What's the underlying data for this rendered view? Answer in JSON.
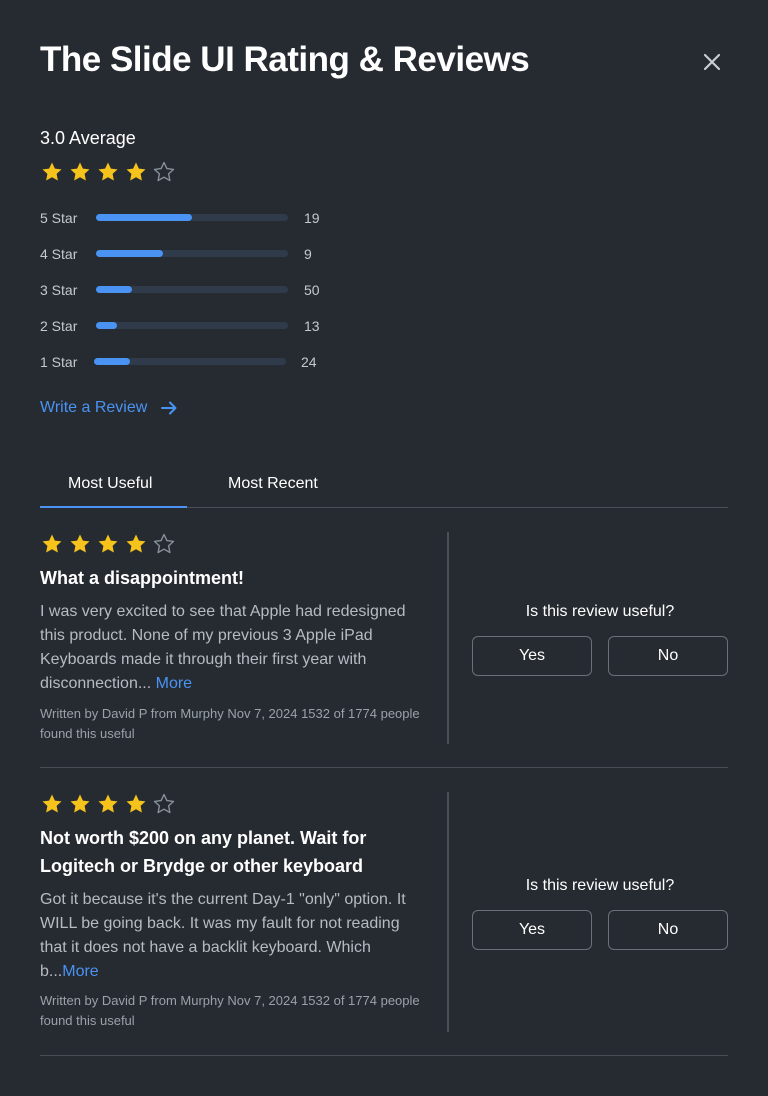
{
  "header": {
    "title": "The Slide UI Rating & Reviews"
  },
  "summary": {
    "average_label": "3.0 Average",
    "stars": 4,
    "max_stars": 5
  },
  "distribution": [
    {
      "label": "5 Star",
      "count": "19",
      "fill": 0.5
    },
    {
      "label": "4 Star",
      "count": "9",
      "fill": 0.35
    },
    {
      "label": "3 Star",
      "count": "50",
      "fill": 0.19
    },
    {
      "label": "2 Star",
      "count": "13",
      "fill": 0.11
    },
    {
      "label": "1 Star",
      "count": "24",
      "fill": 0.19
    }
  ],
  "write_review": {
    "label": "Write a Review"
  },
  "tabs": [
    {
      "label": "Most Useful",
      "active": true
    },
    {
      "label": "Most Recent",
      "active": false
    }
  ],
  "reviews": [
    {
      "stars": 4,
      "title": "What a disappointment!",
      "body": "I was very excited to see that Apple had redesigned this product. None of my previous 3 Apple iPad Keyboards made it through their first year with disconnection... ",
      "more": "More",
      "meta": "Written by David P from Murphy Nov 7, 2024 1532 of 1774 people found this useful",
      "useful_question": "Is this review useful?",
      "yes_label": "Yes",
      "no_label": "No"
    },
    {
      "stars": 4,
      "title": "Not worth $200 on any planet. Wait for Logitech or Brydge or other keyboard",
      "body": "Got it because it's the current Day-1 \"only\" option. It WILL be going back. It was my fault for not reading that it does not have a backlit keyboard. Which b...",
      "more": "More",
      "meta": "Written by David P from Murphy Nov 7, 2024 1532 of 1774 people found this useful",
      "useful_question": "Is this review useful?",
      "yes_label": "Yes",
      "no_label": "No"
    }
  ],
  "colors": {
    "background": "#262b31",
    "accent": "#4a93f3",
    "star_filled": "#f6c21c",
    "star_empty": "#8a9099"
  }
}
